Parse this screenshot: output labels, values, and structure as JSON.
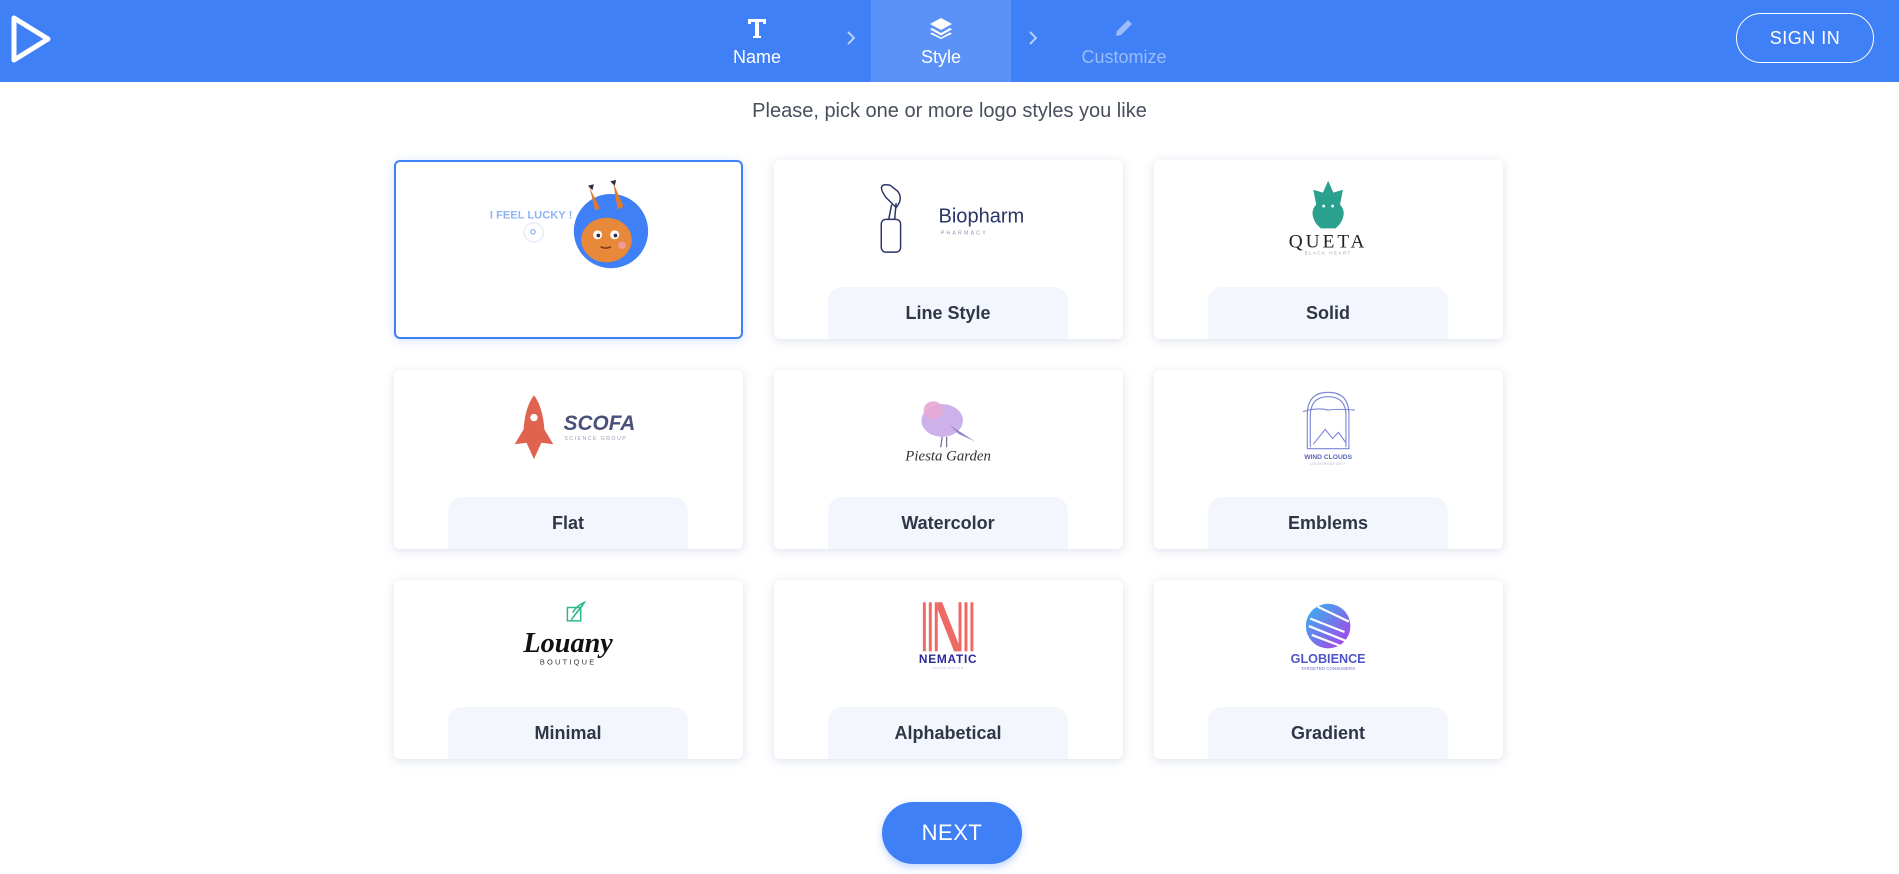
{
  "header": {
    "steps": [
      {
        "label": "Name",
        "icon": "text-icon",
        "state": "done"
      },
      {
        "label": "Style",
        "icon": "layers-icon",
        "state": "active"
      },
      {
        "label": "Customize",
        "icon": "pencil-icon",
        "state": "disabled"
      }
    ],
    "sign_in_label": "SIGN IN"
  },
  "prompt": "Please, pick one or more logo styles you like",
  "styles": [
    {
      "label": "",
      "selected": true,
      "art_text": "I FEEL LUCKY !"
    },
    {
      "label": "Line Style",
      "selected": false,
      "art_text": "Biopharm",
      "art_subtext": "PHARMACY"
    },
    {
      "label": "Solid",
      "selected": false,
      "art_text": "QUETA",
      "art_subtext": "BLACK HEART"
    },
    {
      "label": "Flat",
      "selected": false,
      "art_text": "SCOFA",
      "art_subtext": "SCIENCE GROUP"
    },
    {
      "label": "Watercolor",
      "selected": false,
      "art_text": "Piesta Garden"
    },
    {
      "label": "Emblems",
      "selected": false,
      "art_text": "WIND CLOUDS",
      "art_subtext": "OBSERVATORY"
    },
    {
      "label": "Minimal",
      "selected": false,
      "art_text": "Louany",
      "art_subtext": "BOUTIQUE"
    },
    {
      "label": "Alphabetical",
      "selected": false,
      "art_text": "NEMATIC",
      "art_subtext": "ORGANIZATION"
    },
    {
      "label": "Gradient",
      "selected": false,
      "art_text": "GLOBIENCE",
      "art_subtext": "TARGETED CONSUMERS"
    }
  ],
  "next_label": "NEXT",
  "colors": {
    "header_bg": "#3f80f6",
    "accent": "#3f80f6",
    "label_bg": "#f3f7fd",
    "text": "#2f3645"
  }
}
